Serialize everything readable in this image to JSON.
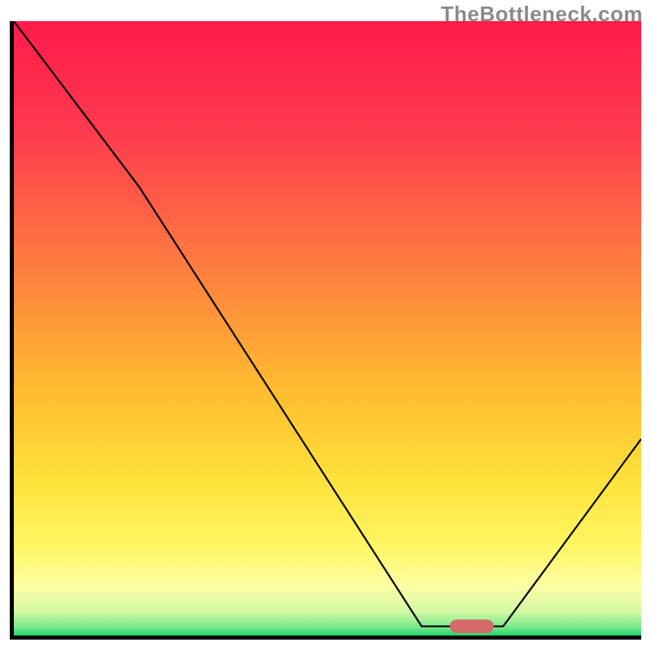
{
  "watermark": "TheBottleneck.com",
  "chart_data": {
    "type": "line",
    "title": "",
    "xlabel": "",
    "ylabel": "",
    "xlim": [
      0,
      100
    ],
    "ylim": [
      0,
      100
    ],
    "series": [
      {
        "name": "bottleneck-curve",
        "x": [
          0,
          20,
          65,
          72,
          78,
          100
        ],
        "values": [
          100,
          73,
          1.5,
          1.5,
          1.5,
          32
        ]
      }
    ],
    "marker": {
      "x": 73,
      "y": 1.5,
      "width": 7,
      "height": 2.2
    },
    "gradient_stops": [
      {
        "offset": 0,
        "color": "#ff1a4b"
      },
      {
        "offset": 18,
        "color": "#ff3a4e"
      },
      {
        "offset": 40,
        "color": "#ff7d3f"
      },
      {
        "offset": 60,
        "color": "#ffbc2f"
      },
      {
        "offset": 75,
        "color": "#ffe23a"
      },
      {
        "offset": 86,
        "color": "#fff766"
      },
      {
        "offset": 92,
        "color": "#fdffa6"
      },
      {
        "offset": 96,
        "color": "#d5f9a4"
      },
      {
        "offset": 98.5,
        "color": "#7fe98d"
      },
      {
        "offset": 100,
        "color": "#26d36e"
      }
    ]
  }
}
